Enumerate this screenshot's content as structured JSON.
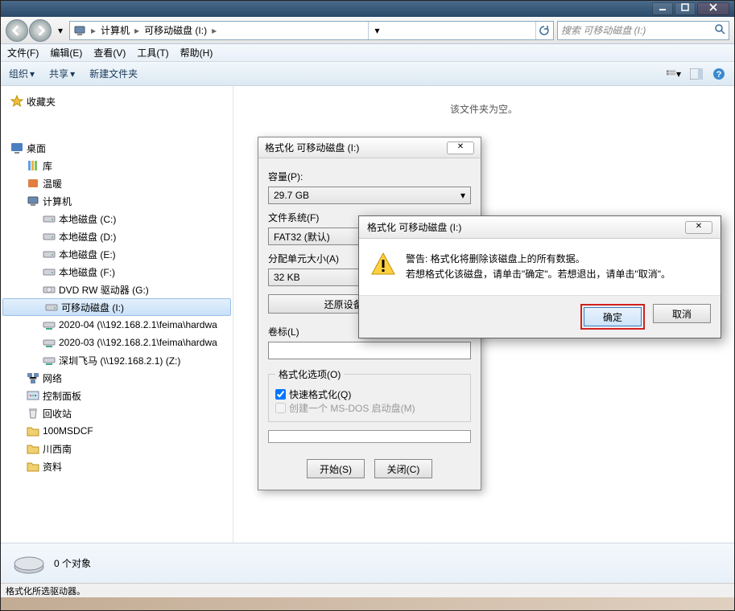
{
  "window": {
    "min": "–",
    "max": "☐",
    "close": "✕"
  },
  "breadcrumb": {
    "root_icon": "computer",
    "segments": [
      "计算机",
      "可移动磁盘 (I:)"
    ]
  },
  "search": {
    "placeholder": "搜索 可移动磁盘 (I:)"
  },
  "menu": {
    "file": "文件(F)",
    "edit": "编辑(E)",
    "view": "查看(V)",
    "tools": "工具(T)",
    "help": "帮助(H)"
  },
  "toolbar": {
    "organize": "组织",
    "share": "共享",
    "newfolder": "新建文件夹"
  },
  "tree": [
    {
      "depth": 0,
      "icon": "star",
      "label": "收藏夹"
    },
    {
      "depth": 0,
      "icon": "blank",
      "label": ""
    },
    {
      "depth": 0,
      "icon": "desktop",
      "label": "桌面"
    },
    {
      "depth": 1,
      "icon": "lib",
      "label": "库"
    },
    {
      "depth": 1,
      "icon": "warm",
      "label": "温暖"
    },
    {
      "depth": 1,
      "icon": "computer",
      "label": "计算机"
    },
    {
      "depth": 2,
      "icon": "drive",
      "label": "本地磁盘 (C:)"
    },
    {
      "depth": 2,
      "icon": "drive",
      "label": "本地磁盘 (D:)"
    },
    {
      "depth": 2,
      "icon": "drive",
      "label": "本地磁盘 (E:)"
    },
    {
      "depth": 2,
      "icon": "drive",
      "label": "本地磁盘 (F:)"
    },
    {
      "depth": 2,
      "icon": "dvd",
      "label": "DVD RW 驱动器 (G:)"
    },
    {
      "depth": 2,
      "icon": "drive",
      "label": "可移动磁盘 (I:)",
      "selected": true
    },
    {
      "depth": 2,
      "icon": "netdrv",
      "label": "2020-04 (\\\\192.168.2.1\\feima\\hardwa"
    },
    {
      "depth": 2,
      "icon": "netdrv",
      "label": "2020-03 (\\\\192.168.2.1\\feima\\hardwa"
    },
    {
      "depth": 2,
      "icon": "netdrv",
      "label": "深圳飞马 (\\\\192.168.2.1) (Z:)"
    },
    {
      "depth": 1,
      "icon": "network",
      "label": "网络"
    },
    {
      "depth": 1,
      "icon": "cpanel",
      "label": "控制面板"
    },
    {
      "depth": 1,
      "icon": "recycle",
      "label": "回收站"
    },
    {
      "depth": 1,
      "icon": "folder",
      "label": "100MSDCF"
    },
    {
      "depth": 1,
      "icon": "folder",
      "label": "川西南"
    },
    {
      "depth": 1,
      "icon": "folder",
      "label": "资料"
    }
  ],
  "content": {
    "empty_message": "该文件夹为空。"
  },
  "statusbar": {
    "count": "0 个对象"
  },
  "footer": {
    "text": "格式化所选驱动器。"
  },
  "format_dialog": {
    "title": "格式化 可移动磁盘 (I:)",
    "capacity_label": "容量(P):",
    "capacity_value": "29.7 GB",
    "filesystem_label": "文件系统(F)",
    "filesystem_value": "FAT32 (默认)",
    "alloc_label": "分配单元大小(A)",
    "alloc_value": "32 KB",
    "restore": "还原设备的默认值(D)",
    "volume_label": "卷标(L)",
    "volume_value": "",
    "options_legend": "格式化选项(O)",
    "quick_format": "快速格式化(Q)",
    "msdos": "创建一个 MS-DOS 启动盘(M)",
    "start": "开始(S)",
    "close": "关闭(C)"
  },
  "warn_dialog": {
    "title": "格式化 可移动磁盘 (I:)",
    "line1": "警告: 格式化将删除该磁盘上的所有数据。",
    "line2": "若想格式化该磁盘，请单击\"确定\"。若想退出，请单击\"取消\"。",
    "ok": "确定",
    "cancel": "取消"
  }
}
